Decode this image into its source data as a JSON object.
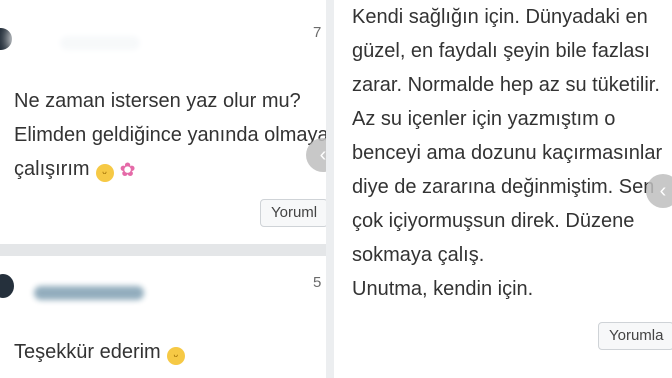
{
  "left_panel": {
    "comments": [
      {
        "comment_count": "7",
        "lines": [
          "Ne zaman istersen yaz olur mu?",
          "Elimden geldiğince yanında olmaya",
          "çalışırım"
        ],
        "reply_label": "Yoruml"
      },
      {
        "comment_count": "5",
        "lines": [
          "Teşekkür ederim"
        ]
      }
    ]
  },
  "right_panel": {
    "lines": [
      "Kendi sağlığın için. Dünyadaki en",
      "güzel, en faydalı şeyin bile fazlası",
      "zarar. Normalde hep az su tüketilir.",
      "Az su içenler için yazmıştım o",
      "benceyi ama dozunu kaçırmasınlar",
      "diye de zararına değinmiştim. Sen",
      "çok içiyormuşsun direk. Düzene",
      "sokmaya çalış.",
      "Unutma, kendin için."
    ],
    "reply_label": "Yorumla"
  },
  "icons": {
    "smile": "smiling-face-emoji",
    "flower": "cherry-blossom-emoji",
    "arrow": "chevron-left-icon"
  }
}
